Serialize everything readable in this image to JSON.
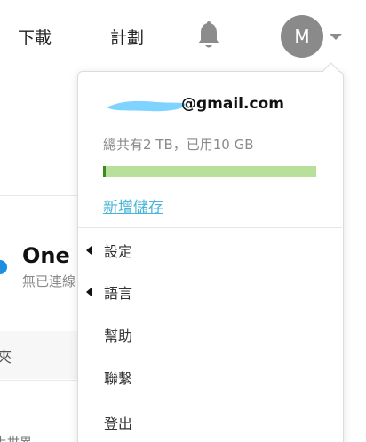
{
  "header": {
    "download_label": "下載",
    "plan_label": "計劃",
    "notifications_icon": "bell-icon",
    "avatar_letter": "M",
    "avatar_color": "#8a8a8a"
  },
  "background": {
    "title": "One D",
    "subtitle": "無已連線",
    "folder_text": "夾",
    "bottom_text": "上世界"
  },
  "account_menu": {
    "email_visible": "@gmail.com",
    "storage_text": "總共有2 TB，已用10 GB",
    "storage_used_fraction": 0.005,
    "storage_bar_color": "#b9e09a",
    "storage_fill_color": "#3a8a1d",
    "add_storage_label": "新增儲存",
    "add_storage_color": "#46b5d8",
    "items": [
      {
        "label": "設定",
        "has_submenu": true
      },
      {
        "label": "語言",
        "has_submenu": true
      },
      {
        "label": "幫助",
        "has_submenu": false
      },
      {
        "label": "聯繫",
        "has_submenu": false
      }
    ],
    "logout_label": "登出"
  }
}
